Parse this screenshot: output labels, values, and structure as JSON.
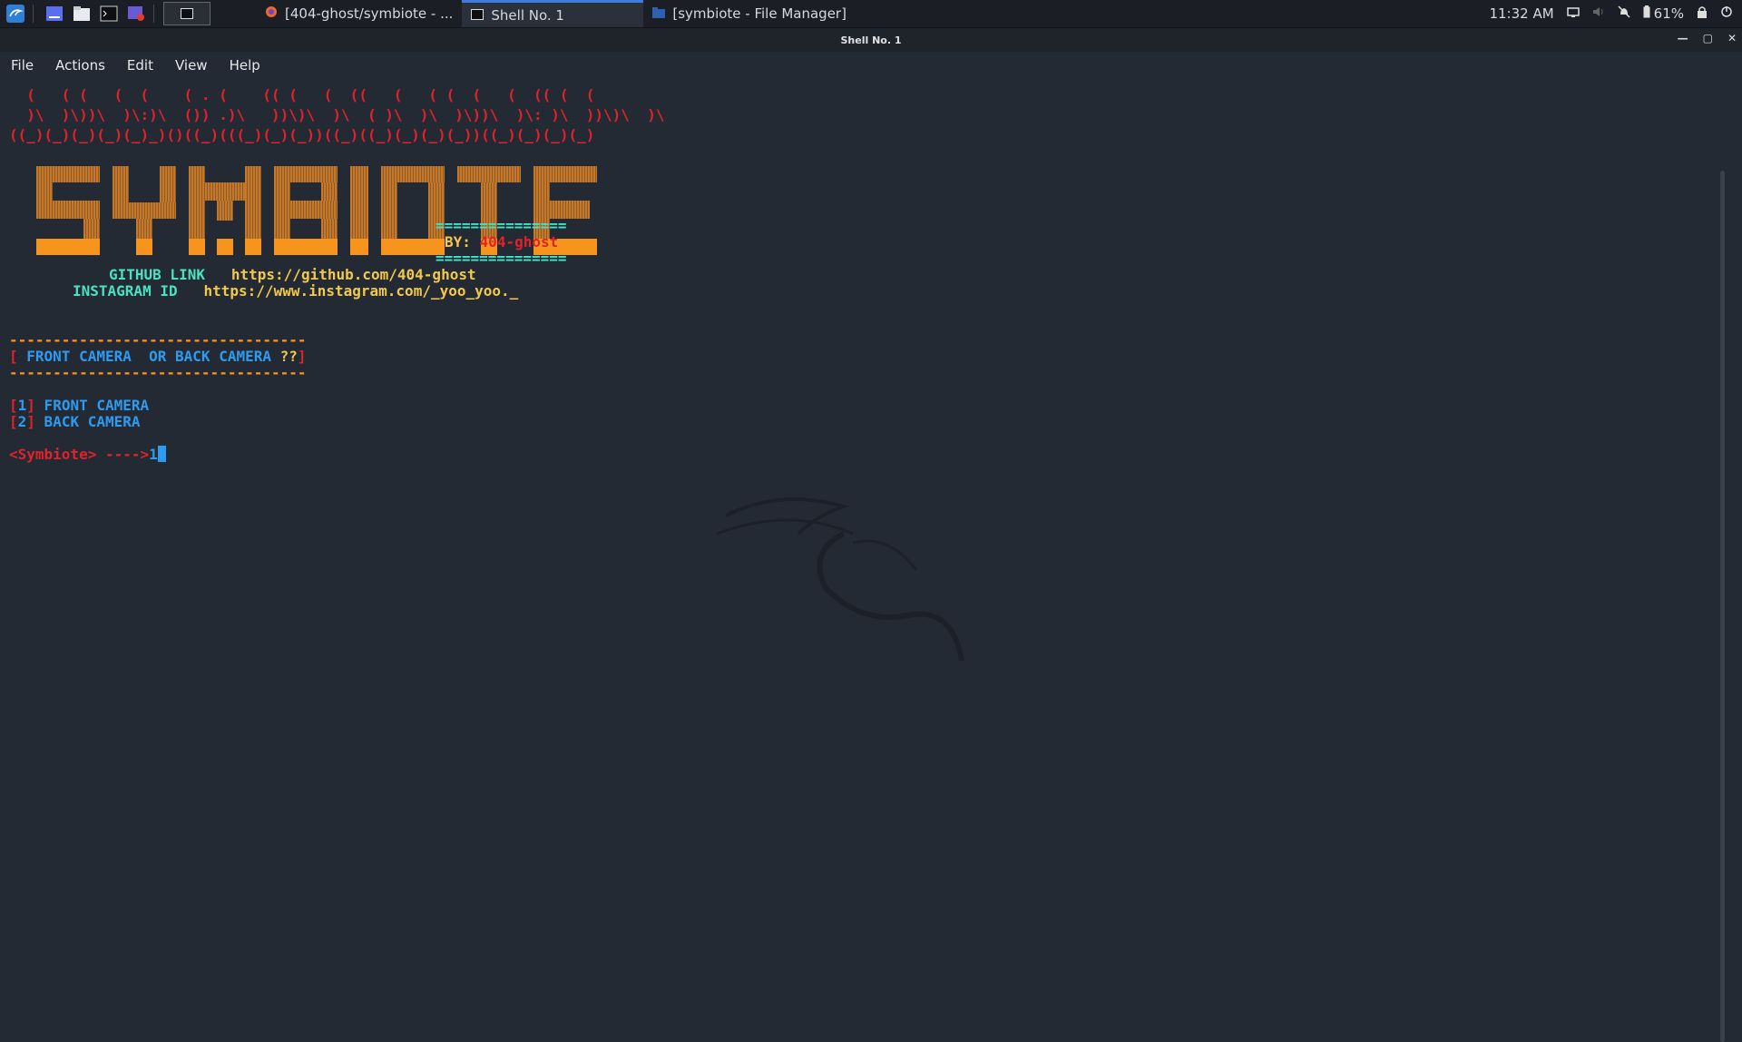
{
  "taskbar": {
    "tasks": [
      {
        "label": "[404-ghost/symbiote - ...",
        "icon": "firefox-icon"
      },
      {
        "label": "Shell No. 1",
        "icon": "terminal-icon"
      },
      {
        "label": "[symbiote - File Manager]",
        "icon": "folder-icon"
      }
    ],
    "time": "11:32 AM",
    "battery": "61%"
  },
  "window": {
    "title": "Shell No. 1",
    "menu": [
      "File",
      "Actions",
      "Edit",
      "View",
      "Help"
    ]
  },
  "terminal": {
    "art_line1": "  (   ( (   (  (    ( . (    (( (   (  ((   (   ( (  (   (  (( (  (",
    "art_line2": "  )\\  )\\))\\  )\\:)\\  ()) .)\\   ))\\)\\  )\\  ( )\\  )\\  )\\))\\  )\\: )\\  ))\\)\\  )\\",
    "art_line3": "((_)(_)(_)(_)(_)_)()((_)(((_)(_)(_))((_)((_)(_)(_)(_))((_)(_)(_)(_)",
    "sep_eq": "===============",
    "by_label": "BY:",
    "by_name": "404-ghost",
    "github_label": "GITHUB LINK",
    "github_url": "https://github.com/404-ghost",
    "insta_label": "INSTAGRAM ID",
    "insta_url": "https://www.instagram.com/_yoo_yoo._",
    "dashes": "----------------------------------",
    "question_open": "[",
    "question_text": " FRONT CAMERA  OR BACK CAMERA ",
    "question_marks": "??",
    "question_close": "]",
    "opt1_num": "1",
    "opt1_label": " FRONT CAMERA",
    "opt2_num": "2",
    "opt2_label": " BACK CAMERA",
    "prompt": "<Symbiote> ---->",
    "input": "1"
  }
}
